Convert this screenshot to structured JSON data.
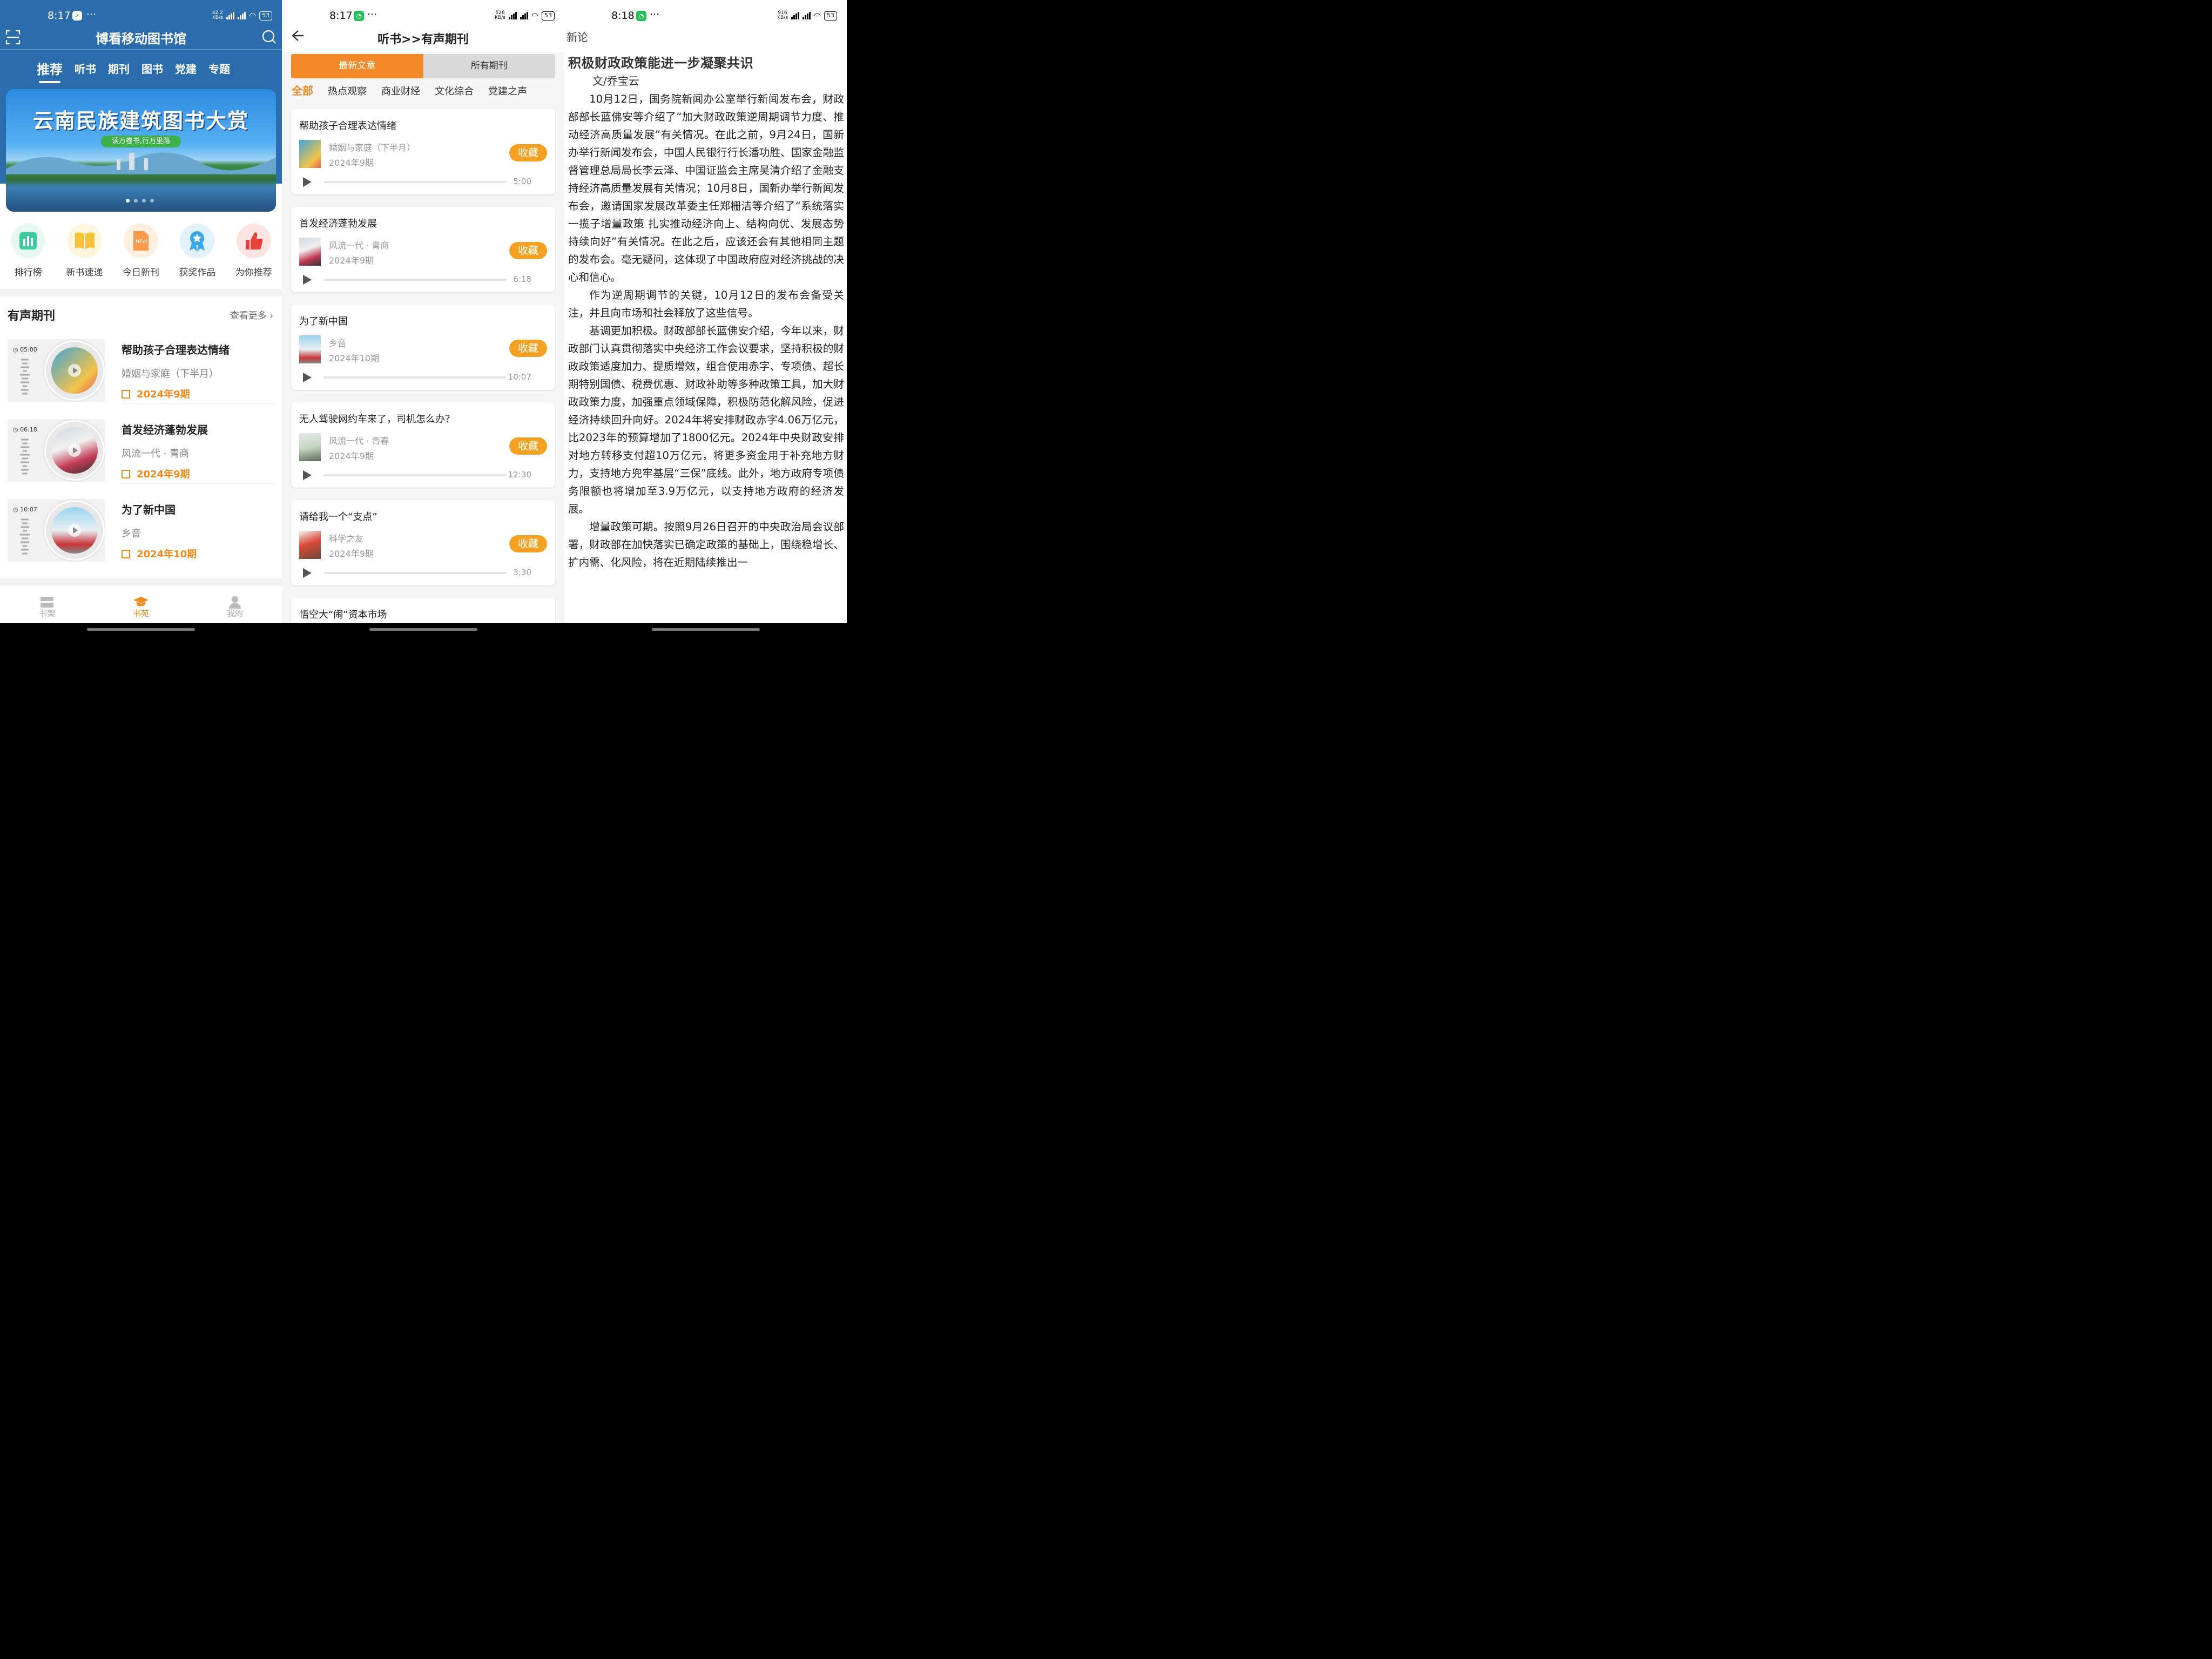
{
  "panel1": {
    "status": {
      "time": "8:17",
      "speed": "42.2",
      "speed_unit": "KB/s",
      "battery": "53"
    },
    "title": "博看移动图书馆",
    "tabs": [
      "推荐",
      "听书",
      "期刊",
      "图书",
      "党建",
      "专题"
    ],
    "banner": {
      "title": "云南民族建筑图书大赏",
      "subtitle": "读万卷书,行万里路"
    },
    "quick": [
      {
        "label": "排行榜",
        "icon": "bar-chart-icon",
        "color": "#3ccba0"
      },
      {
        "label": "新书速递",
        "icon": "open-book-icon",
        "color": "#f5c23a"
      },
      {
        "label": "今日新刊",
        "icon": "new-document-icon",
        "color": "#f79a4a"
      },
      {
        "label": "获奖作品",
        "icon": "award-ribbon-icon",
        "color": "#3aa8e6"
      },
      {
        "label": "为你推荐",
        "icon": "thumbs-up-icon",
        "color": "#e8423b"
      }
    ],
    "section": {
      "title": "有声期刊",
      "more": "查看更多"
    },
    "items": [
      {
        "duration": "05:00",
        "title": "帮助孩子合理表达情绪",
        "magazine": "婚姻与家庭（下半月）",
        "issue": "2024年9期"
      },
      {
        "duration": "06:18",
        "title": "首发经济蓬勃发展",
        "magazine": "风流一代 · 青商",
        "issue": "2024年9期"
      },
      {
        "duration": "10:07",
        "title": "为了新中国",
        "magazine": "乡音",
        "issue": "2024年10期"
      }
    ],
    "nav": [
      {
        "label": "书架",
        "icon": "bookshelf-icon"
      },
      {
        "label": "书苑",
        "icon": "graduation-cap-icon"
      },
      {
        "label": "我的",
        "icon": "user-icon"
      }
    ]
  },
  "panel2": {
    "status": {
      "time": "8:17",
      "speed": "528",
      "speed_unit": "KB/s",
      "battery": "53"
    },
    "title": "听书>>有声期刊",
    "segments": [
      "最新文章",
      "所有期刊"
    ],
    "categories": [
      "全部",
      "热点观察",
      "商业财经",
      "文化综合",
      "党建之声"
    ],
    "fav_label": "收藏",
    "cards": [
      {
        "title": "帮助孩子合理表达情绪",
        "magazine": "婚姻与家庭（下半月）",
        "issue": "2024年9期",
        "duration": "5:00"
      },
      {
        "title": "首发经济蓬勃发展",
        "magazine": "风流一代 · 青商",
        "issue": "2024年9期",
        "duration": "6:18"
      },
      {
        "title": "为了新中国",
        "magazine": "乡音",
        "issue": "2024年10期",
        "duration": "10:07"
      },
      {
        "title": "无人驾驶网约车来了，司机怎么办？",
        "magazine": "风流一代 · 青春",
        "issue": "2024年9期",
        "duration": "12:30"
      },
      {
        "title": "请给我一个“支点”",
        "magazine": "科学之友",
        "issue": "2024年9期",
        "duration": "3:30"
      }
    ],
    "partial_title": "悟空大“闹”资本市场"
  },
  "panel3": {
    "status": {
      "time": "8:18",
      "speed": "916",
      "speed_unit": "KB/s",
      "battery": "53"
    },
    "header": "新论",
    "title": "积极财政政策能进一步凝聚共识",
    "author": "文/乔宝云",
    "paragraphs": [
      "10月12日，国务院新闻办公室举行新闻发布会，财政部部长蓝佛安等介绍了“加大财政政策逆周期调节力度、推动经济高质量发展”有关情况。在此之前，9月24日，国新办举行新闻发布会，中国人民银行行长潘功胜、国家金融监督管理总局局长李云泽、中国证监会主席吴清介绍了金融支持经济高质量发展有关情况；10月8日，国新办举行新闻发布会，邀请国家发展改革委主任郑栅洁等介绍了“系统落实一揽子增量政策 扎实推动经济向上、结构向优、发展态势持续向好”有关情况。在此之后，应该还会有其他相同主题的发布会。毫无疑问，这体现了中国政府应对经济挑战的决心和信心。",
      "作为逆周期调节的关键，10月12日的发布会备受关注，并且向市场和社会释放了这些信号。",
      "基调更加积极。财政部部长蓝佛安介绍，今年以来，财政部门认真贯彻落实中央经济工作会议要求，坚持积极的财政政策适度加力、提质增效，组合使用赤字、专项债、超长期特别国债、税费优惠、财政补助等多种政策工具，加大财政政策力度，加强重点领域保障，积极防范化解风险，促进经济持续回升向好。2024年将安排财政赤字4.06万亿元，比2023年的预算增加了1800亿元。2024年中央财政安排对地方转移支付超10万亿元，将更多资金用于补充地方财力，支持地方兜牢基层“三保”底线。此外，地方政府专项债务限额也将增加至3.9万亿元，以支持地方政府的经济发展。",
      "增量政策可期。按照9月26日召开的中央政治局会议部署，财政部在加快落实已确定政策的基础上，围绕稳增长、扩内需、化风险，将在近期陆续推出一"
    ]
  }
}
